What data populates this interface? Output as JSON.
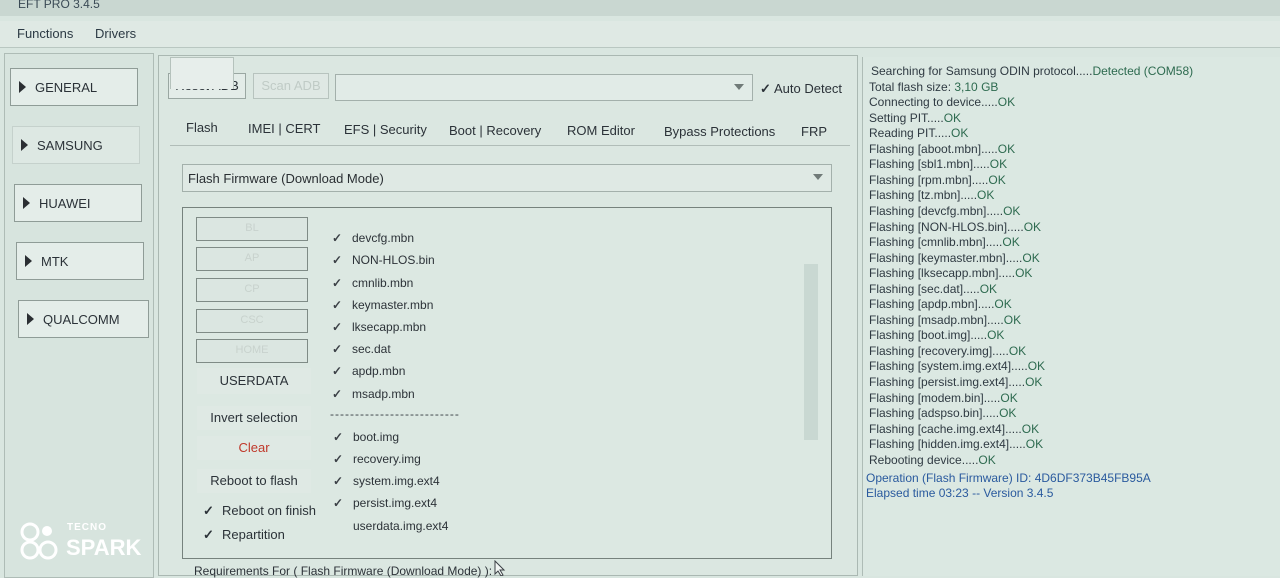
{
  "window": {
    "title": "EFT PRO 3.4.5"
  },
  "menu": [
    "Functions",
    "Drivers"
  ],
  "vendors": [
    "GENERAL",
    "SAMSUNG",
    "HUAWEI",
    "MTK",
    "QUALCOMM"
  ],
  "toolbar": {
    "reset_adb": "Reset ADB",
    "scan_adb": "Scan ADB",
    "port_value": "",
    "auto_detect": "Auto Detect"
  },
  "tabs": [
    "Flash",
    "IMEI | CERT",
    "EFS | Security",
    "Boot | Recovery",
    "ROM Editor",
    "Bypass Protections",
    "FRP"
  ],
  "mode_select": "Flash Firmware (Download Mode)",
  "file_buttons": [
    "BL",
    "AP",
    "CP",
    "CSC",
    "HOME"
  ],
  "actions": {
    "userdata": "USERDATA",
    "invert": "Invert selection",
    "clear": "Clear",
    "reboot_to_flash": "Reboot to flash",
    "reboot_on_finish": "Reboot on finish",
    "repartition": "Repartition"
  },
  "partitions_top": [
    "devcfg.mbn",
    "NON-HLOS.bin",
    "cmnlib.mbn",
    "keymaster.mbn",
    "lksecapp.mbn",
    "sec.dat",
    "apdp.mbn",
    "msadp.mbn"
  ],
  "separator": "--------------------------",
  "partitions_bottom": [
    "boot.img",
    "recovery.img",
    "system.img.ext4",
    "persist.img.ext4",
    "userdata.img.ext4"
  ],
  "requirements": "Requirements For ( Flash Firmware (Download Mode) ):",
  "log": [
    {
      "a": "Searching for Samsung ODIN protocol.....",
      "b": "Detected (COM58)"
    },
    {
      "a": "Total flash size: ",
      "b": "3,10 GB"
    },
    {
      "a": "Connecting to device.....",
      "b": "OK"
    },
    {
      "a": "Setting PIT.....",
      "b": "OK"
    },
    {
      "a": "Reading PIT.....",
      "b": "OK"
    },
    {
      "a": "Flashing [aboot.mbn].....",
      "b": "OK"
    },
    {
      "a": "Flashing [sbl1.mbn].....",
      "b": "OK"
    },
    {
      "a": "Flashing [rpm.mbn].....",
      "b": "OK"
    },
    {
      "a": "Flashing [tz.mbn].....",
      "b": "OK"
    },
    {
      "a": "Flashing [devcfg.mbn].....",
      "b": "OK"
    },
    {
      "a": "Flashing [NON-HLOS.bin].....",
      "b": "OK"
    },
    {
      "a": "Flashing [cmnlib.mbn].....",
      "b": "OK"
    },
    {
      "a": "Flashing [keymaster.mbn].....",
      "b": "OK"
    },
    {
      "a": "Flashing [lksecapp.mbn].....",
      "b": "OK"
    },
    {
      "a": "Flashing [sec.dat].....",
      "b": "OK"
    },
    {
      "a": "Flashing [apdp.mbn].....",
      "b": "OK"
    },
    {
      "a": "Flashing [msadp.mbn].....",
      "b": "OK"
    },
    {
      "a": "Flashing [boot.img].....",
      "b": "OK"
    },
    {
      "a": "Flashing [recovery.img].....",
      "b": "OK"
    },
    {
      "a": "Flashing [system.img.ext4].....",
      "b": "OK"
    },
    {
      "a": "Flashing [persist.img.ext4].....",
      "b": "OK"
    },
    {
      "a": "Flashing [modem.bin].....",
      "b": "OK"
    },
    {
      "a": "Flashing [adspso.bin].....",
      "b": "OK"
    },
    {
      "a": "Flashing [cache.img.ext4].....",
      "b": "OK"
    },
    {
      "a": "Flashing [hidden.img.ext4].....",
      "b": "OK"
    },
    {
      "a": "Rebooting device.....",
      "b": "OK"
    }
  ],
  "operation": "Operation (Flash Firmware) ID: 4D6DF373B45FB95A",
  "elapsed": "Elapsed time 03:23 -- Version 3.4.5",
  "brand": {
    "small": "TECNO",
    "big": "SPARK"
  }
}
